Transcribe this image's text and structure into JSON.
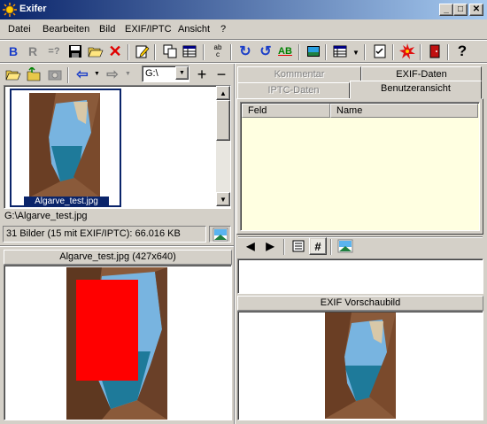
{
  "window": {
    "title": "Exifer"
  },
  "menu": [
    {
      "label": "Datei"
    },
    {
      "label": "Bearbeiten"
    },
    {
      "label": "Bild"
    },
    {
      "label": "EXIF/IPTC"
    },
    {
      "label": "Ansicht"
    },
    {
      "label": "?"
    }
  ],
  "toolbar": {
    "bold_b": "B",
    "gray_r": "R",
    "eq_label": "=?",
    "abc_label": "ab\nc",
    "ab_label": "AB"
  },
  "browser": {
    "drive_select": "G:\\",
    "thumbnail_caption": "Algarve_test.jpg",
    "path": "G:\\Algarve_test.jpg",
    "stats": "31 Bilder (15 mit EXIF/IPTC): 66.016 KB",
    "preview_title": "Algarve_test.jpg (427x640)"
  },
  "tabs": {
    "kommentar": "Kommentar",
    "exif_daten": "EXIF-Daten",
    "iptc_daten": "IPTC-Daten",
    "benutzeransicht": "Benutzeransicht"
  },
  "table": {
    "columns": [
      "Feld",
      "Name"
    ]
  },
  "exif_preview": {
    "title": "EXIF Vorschaubild"
  },
  "colors": {
    "title_gradient_start": "#0a246a",
    "title_gradient_end": "#a6caf0",
    "face": "#d4d0c8",
    "table_bg": "#ffffe1",
    "redact": "#ff0000",
    "selection_border": "#0a246a"
  }
}
